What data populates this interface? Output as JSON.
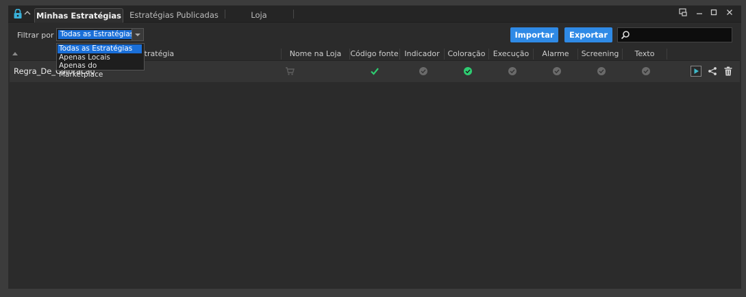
{
  "tabs": [
    {
      "label": "Minhas Estratégias",
      "active": true
    },
    {
      "label": "Estratégias Publicadas",
      "active": false
    },
    {
      "label": "Loja",
      "active": false
    }
  ],
  "filter": {
    "label": "Filtrar por",
    "selected": "Todas as Estratégias",
    "options": [
      "Todas as Estratégias",
      "Apenas Locais",
      "Apenas do Marketplace"
    ]
  },
  "toolbar": {
    "import_label": "Importar",
    "export_label": "Exportar"
  },
  "search": {
    "placeholder": ""
  },
  "table": {
    "name_header": "Estratégia",
    "columns": [
      "Nome na Loja",
      "Código fonte",
      "Indicador",
      "Coloração",
      "Execução",
      "Alarme",
      "Screening",
      "Texto"
    ],
    "rows": [
      {
        "name": "Regra_De_Coloracao",
        "cells": [
          "cart-icon",
          "check-icon",
          "check-circle-gray-icon",
          "check-circle-green-icon",
          "check-circle-gray-icon",
          "check-circle-gray-icon",
          "check-circle-gray-icon",
          "check-circle-gray-icon"
        ],
        "actions": [
          "play-icon",
          "share-icon",
          "trash-icon"
        ]
      }
    ]
  },
  "colors": {
    "accent": "#2f8ae6",
    "green": "#2ecc71",
    "gray_check": "#7a7a7a",
    "play": "#3fb8c8"
  }
}
